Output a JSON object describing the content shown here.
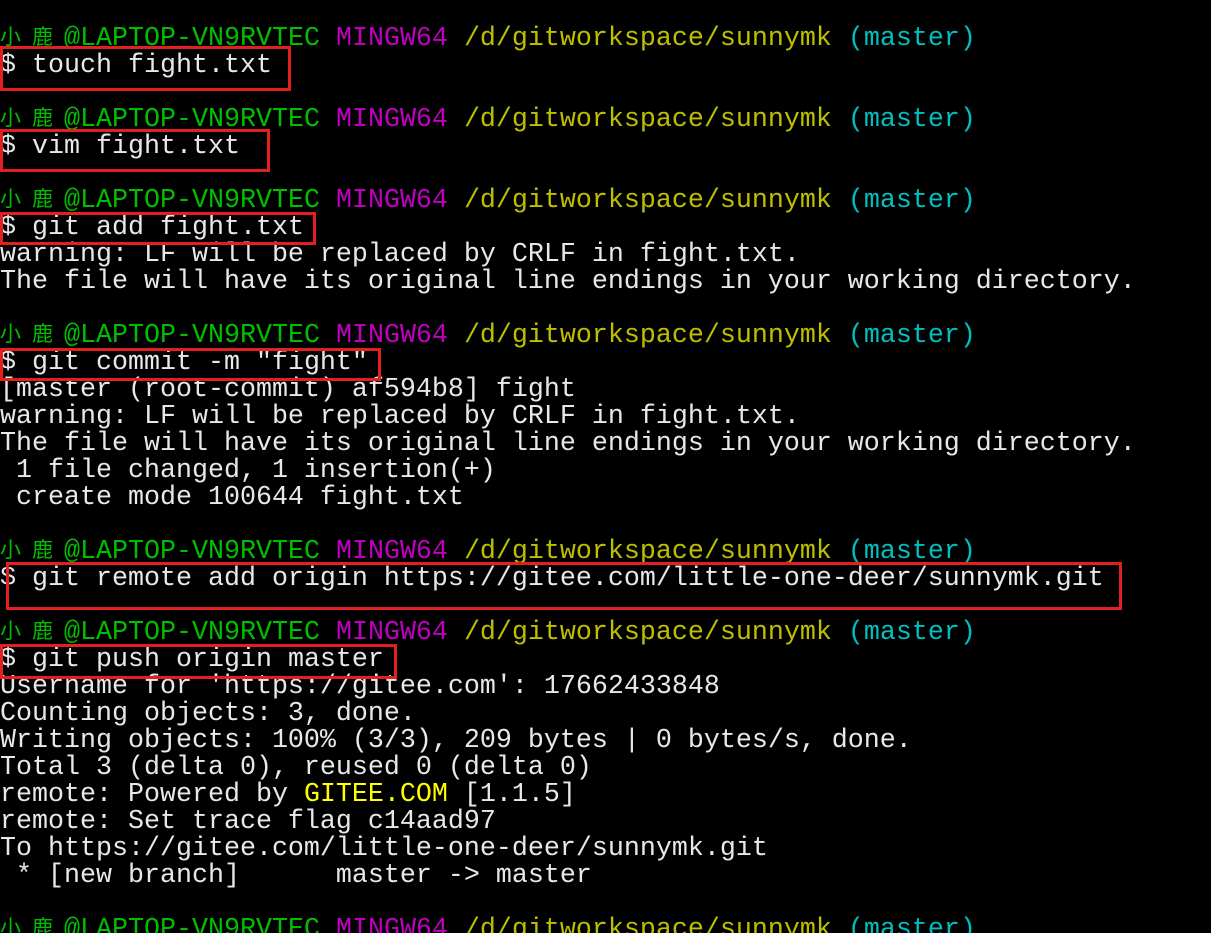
{
  "terminal": {
    "colors": {
      "background": "#000000",
      "foreground": "#E8E8E8",
      "user_host": "#00BF00",
      "system": "#BF00BF",
      "cwd": "#BFBF00",
      "branch": "#00BFBF",
      "bright_yellow": "#FFFF00",
      "annotation": "#E4201E"
    },
    "prompt": {
      "user": "小鹿",
      "host": "@LAPTOP-VN9RVTEC",
      "system": "MINGW64",
      "cwd": "/d/gitworkspace/sunnymk",
      "branch": "(master)",
      "symbol": "$"
    },
    "session": [
      {
        "command": "touch fight.txt",
        "output": []
      },
      {
        "command": "vim fight.txt",
        "output": []
      },
      {
        "command": "git add fight.txt",
        "output": [
          "warning: LF will be replaced by CRLF in fight.txt.",
          "The file will have its original line endings in your working directory."
        ]
      },
      {
        "command": "git commit -m \"fight\"",
        "output": [
          "[master (root-commit) af594b8] fight",
          "warning: LF will be replaced by CRLF in fight.txt.",
          "The file will have its original line endings in your working directory.",
          " 1 file changed, 1 insertion(+)",
          " create mode 100644 fight.txt"
        ]
      },
      {
        "command": "git remote add origin https://gitee.com/little-one-deer/sunnymk.git",
        "output": []
      },
      {
        "command": "git push origin master",
        "output": [
          "Username for 'https://gitee.com': 17662433848",
          "Counting objects: 3, done.",
          "Writing objects: 100% (3/3), 209 bytes | 0 bytes/s, done.",
          "Total 3 (delta 0), reused 0 (delta 0)",
          {
            "prefix": "remote: Powered by ",
            "highlight": "GITEE.COM",
            "suffix": " [1.1.5]"
          },
          "remote: Set trace flag c14aad97",
          "To https://gitee.com/little-one-deer/sunnymk.git",
          " * [new branch]      master -> master"
        ]
      }
    ]
  }
}
